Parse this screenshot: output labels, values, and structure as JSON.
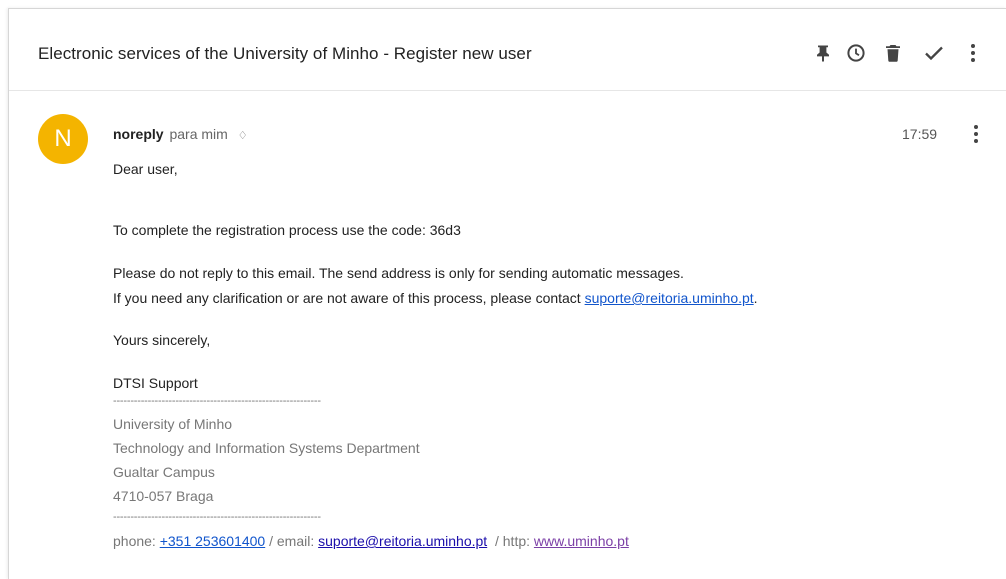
{
  "thread": {
    "subject": "Electronic services of the University of Minho - Register new user",
    "actions": [
      {
        "name": "pin-icon",
        "label": "Pin"
      },
      {
        "name": "clock-icon",
        "label": "Snooze"
      },
      {
        "name": "trash-icon",
        "label": "Delete"
      },
      {
        "name": "check-icon",
        "label": "Done"
      },
      {
        "name": "more-vert-icon",
        "label": "More"
      }
    ]
  },
  "message": {
    "avatar_letter": "N",
    "avatar_color": "#f4b400",
    "sender": "noreply",
    "recipient": "para mim",
    "recipient_toggle": "♢",
    "time": "17:59",
    "greeting": "Dear user,",
    "code_line": "To complete the registration process use the code: 36d3",
    "notice_line1": "Please do not reply to this email. The send address is only for sending automatic messages.",
    "notice_line2_prefix": "If you need any clarification or are not aware of this process, please contact ",
    "support_email": "suporte@reitoria.uminho.pt",
    "notice_line2_suffix": ".",
    "closing": "Yours sincerely,",
    "signoff": "DTSI Support",
    "separator": "------------------------------------------------------------",
    "signature": {
      "line1": "University of Minho",
      "line2": "Technology and Information Systems Department",
      "line3": "Gualtar Campus",
      "line4": "4710-057 Braga",
      "phone_label": "phone: ",
      "phone": "+351 253601400",
      "email_label": " / email: ",
      "email": "suporte@reitoria.uminho.pt",
      "http_label": "  / http: ",
      "website": "www.uminho.pt"
    }
  }
}
